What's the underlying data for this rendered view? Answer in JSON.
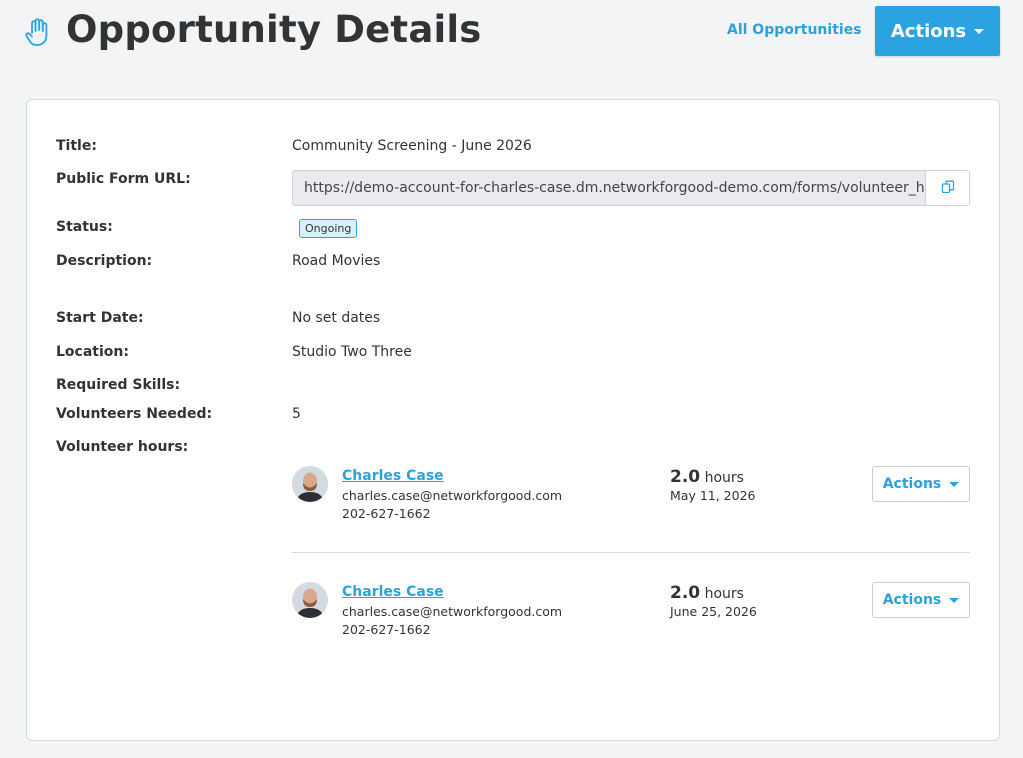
{
  "header": {
    "title": "Opportunity Details",
    "all_opportunities_label": "All Opportunities",
    "actions_label": "Actions"
  },
  "details": {
    "title_label": "Title:",
    "title_value": "Community Screening - June 2026",
    "url_label": "Public Form URL:",
    "url_value": "https://demo-account-for-charles-case.dm.networkforgood-demo.com/forms/volunteer_ho",
    "status_label": "Status:",
    "status_value": "Ongoing",
    "description_label": "Description:",
    "description_value": "Road Movies",
    "start_date_label": "Start Date:",
    "start_date_value": "No set dates",
    "location_label": "Location:",
    "location_value": "Studio Two Three",
    "skills_label": "Required Skills:",
    "volunteers_label": "Volunteers Needed:",
    "volunteers_value": "5",
    "hours_label": "Volunteer hours:"
  },
  "volunteer_hours": [
    {
      "name": "Charles Case",
      "email": "charles.case@networkforgood.com",
      "phone": "202-627-1662",
      "hours": "2.0",
      "hours_unit": "hours",
      "date": "May 11, 2026",
      "actions_label": "Actions"
    },
    {
      "name": "Charles Case",
      "email": "charles.case@networkforgood.com",
      "phone": "202-627-1662",
      "hours": "2.0",
      "hours_unit": "hours",
      "date": "June 25, 2026",
      "actions_label": "Actions"
    }
  ],
  "icons": {
    "header": "hand-icon",
    "copy": "copy-icon",
    "dropdown": "caret-down-icon"
  },
  "colors": {
    "accent": "#2ba3e0",
    "link": "#2ba3d8",
    "badge_bg": "#d9f1fb"
  }
}
